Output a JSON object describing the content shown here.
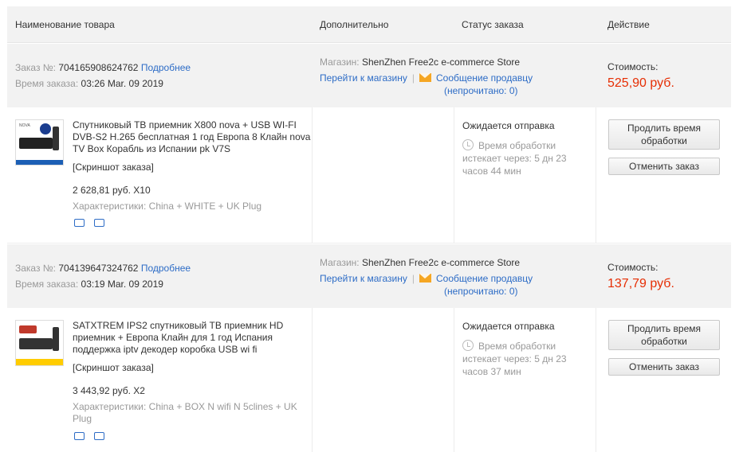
{
  "header": {
    "col_product": "Наименование товара",
    "col_extra": "Дополнительно",
    "col_status": "Статус заказа",
    "col_action": "Действие"
  },
  "labels": {
    "order_no": "Заказ №:",
    "order_time": "Время заказа:",
    "details": "Подробнее",
    "store": "Магазин:",
    "go_to_store": "Перейти к магазину",
    "message_seller": "Сообщение продавцу",
    "unread_prefix": "(непрочитано: ",
    "unread_suffix": ")",
    "cost": "Стоимость:",
    "screenshot": "[Скриншот заказа]",
    "specs": "Характеристики:",
    "status_waiting": "Ожидается отправка",
    "processing_time": "Время обработки",
    "expires_in": "истекает через:",
    "extend_btn_line1": "Продлить время",
    "extend_btn_line2": "обработки",
    "cancel_btn": "Отменить заказ"
  },
  "orders": [
    {
      "number": "704165908624762",
      "time": "03:26 Mar. 09 2019",
      "store": "ShenZhen Free2c e-commerce Store",
      "unread": "0",
      "cost": "525,90 руб.",
      "product_name": "Спутниковый ТВ приемник X800 nova + USB WI-FI DVB-S2 H.265 бесплатная 1 год Европа 8 Клайн nova TV Box Корабль из Испании pk V7S",
      "price_qty": "2 628,81 руб. X10",
      "specs": "China + WHITE + UK Plug",
      "remaining_line1": "5 дн 23",
      "remaining_line2": "часов 44 мин"
    },
    {
      "number": "704139647324762",
      "time": "03:19 Mar. 09 2019",
      "store": "ShenZhen Free2c e-commerce Store",
      "unread": "0",
      "cost": "137,79 руб.",
      "product_name": "SATXTREM IPS2 спутниковый ТВ приемник HD приемник + Европа Клайн для 1 год Испания поддержка iptv декодер коробка USB wi fi",
      "price_qty": "3 443,92 руб. X2",
      "specs": "China + BOX N wifi N 5clines + UK Plug",
      "remaining_line1": "5 дн 23",
      "remaining_line2": "часов 37 мин"
    }
  ],
  "icons": {
    "mail": "envelope-icon",
    "clock": "clock-icon",
    "shipping": "truck-icon",
    "return": "return-icon"
  },
  "colors": {
    "link": "#2d6cc6",
    "price": "#e62e04",
    "mail": "#f5a623"
  }
}
